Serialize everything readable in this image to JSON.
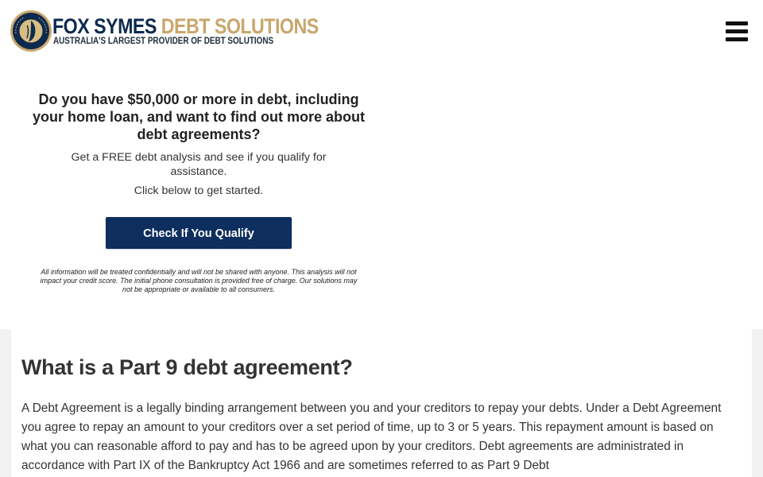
{
  "header": {
    "logo": {
      "brand_part1": "FOX SYMES",
      "brand_part2": "DEBT SOLUTIONS",
      "tagline": "AUSTRALIA'S LARGEST PROVIDER OF DEBT SOLUTIONS",
      "seal_icon": "circular-seal-emblem-icon"
    },
    "menu_icon": "hamburger-menu-icon"
  },
  "promo": {
    "heading": "Do you have $50,000 or more in debt, including your home loan, and want to find out more about debt agreements?",
    "subtext": "Get a FREE debt analysis and see if you qualify for assistance.",
    "cta_text": "Click below to get started.",
    "button_label": "Check If You Qualify",
    "disclaimer": "All information will be treated confidentially and will not be shared with anyone. This analysis will not impact your credit score. The initial phone consultation is provided free of charge. Our solutions may not be appropriate or available to all consumers."
  },
  "article": {
    "title": "What is a Part 9 debt agreement?",
    "body": "A Debt Agreement is a legally binding arrangement between you and your creditors to repay your debts. Under a Debt Agreement you agree to repay an amount to your creditors over a set period of time, up to 3 or 5 years. This repayment amount is based on what you can reasonable afford to pay and has to be agreed upon by your creditors. Debt agreements are administrated in accordance with Part IX of the Bankruptcy Act 1966 and are sometimes referred to as Part 9 Debt"
  },
  "colors": {
    "brand_navy": "#0d2e5e",
    "brand_gold": "#c9a66b",
    "text": "#333333",
    "band_gray": "#f2f2f2"
  }
}
